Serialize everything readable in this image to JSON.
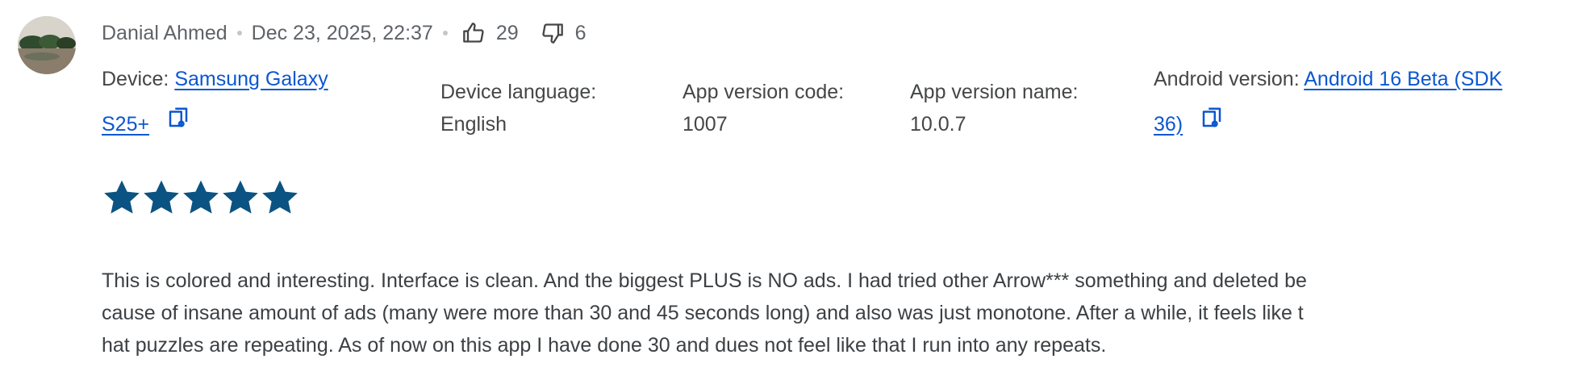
{
  "review": {
    "author": "Danial Ahmed",
    "date": "Dec 23, 2025, 22:37",
    "thumbs_up_count": "29",
    "thumbs_down_count": "6",
    "rating": 5,
    "device": {
      "label": "Device:",
      "value_line1": "Samsung Galaxy",
      "value_line2": "S25+"
    },
    "device_language": {
      "label": "Device language:",
      "value": "English"
    },
    "app_version_code": {
      "label": "App version code:",
      "value": "1007"
    },
    "app_version_name": {
      "label": "App version name:",
      "value": "10.0.7"
    },
    "android_version": {
      "label": "Android version:",
      "value_line1": "Android 16 Beta (SDK",
      "value_line2": "36)"
    },
    "text_lines": [
      "This is colored and interesting. Interface is clean. And the biggest PLUS is NO ads. I had tried other Arrow*** something and deleted be",
      "cause of insane amount of ads (many were more than 30 and 45 seconds long) and also was just monotone. After a while, it feels like t",
      "hat puzzles are repeating. As of now on this app I have done 30 and dues not feel like that I run into any repeats."
    ]
  },
  "icons": {
    "thumbs_up": "thumbs-up-icon",
    "thumbs_down": "thumbs-down-icon",
    "copy": "copy-icon",
    "star": "star-icon"
  },
  "colors": {
    "link": "#0b57d0",
    "star": "#0b5382",
    "text": "#444746"
  }
}
